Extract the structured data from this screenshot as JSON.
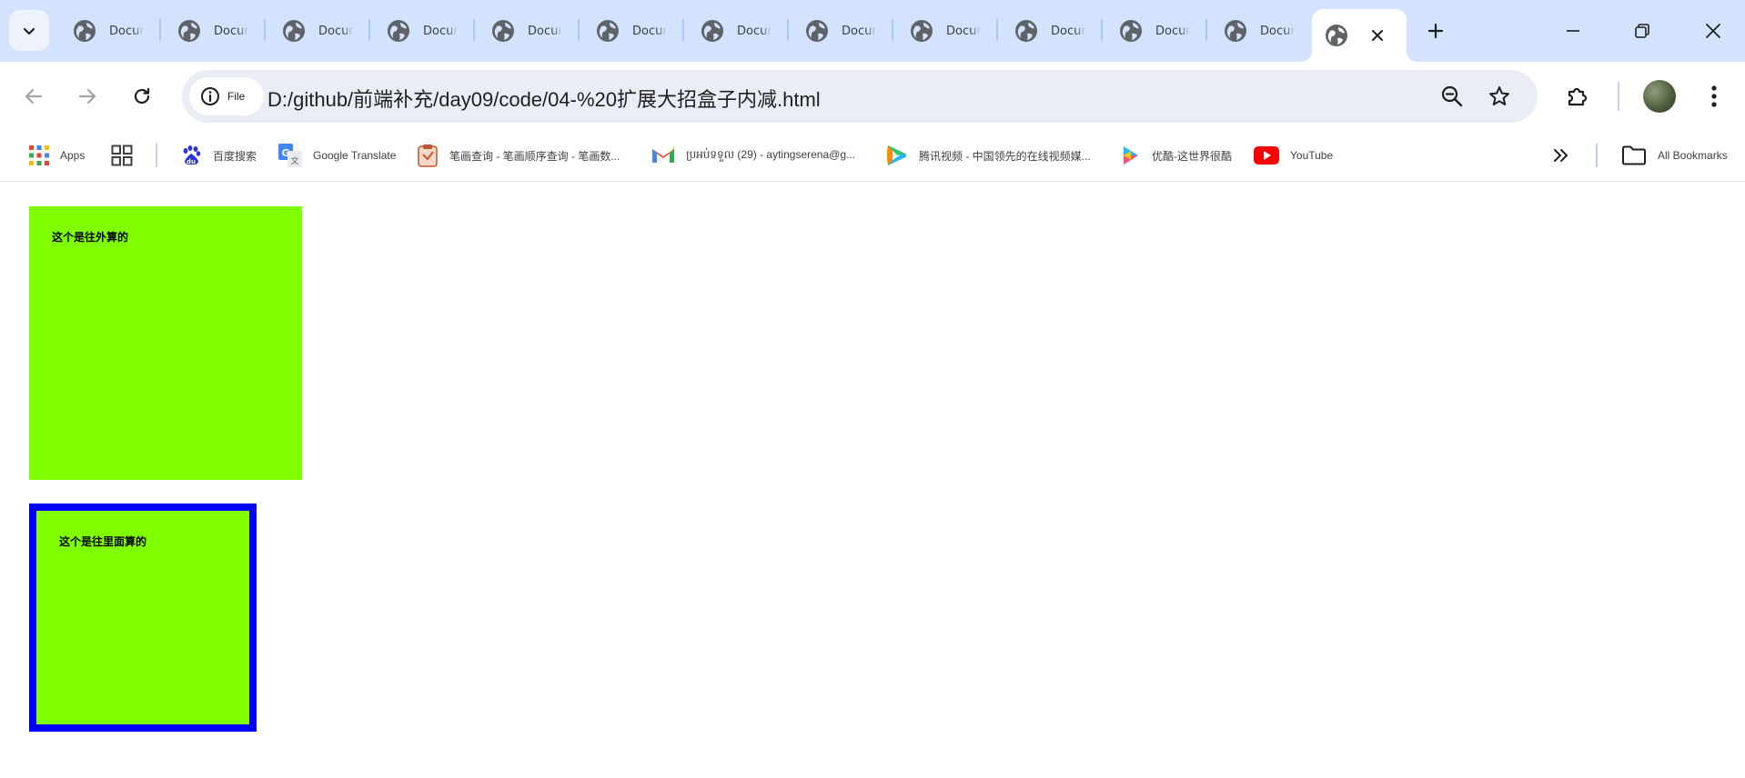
{
  "colors": {
    "tabstrip_bg": "#d3e3fd",
    "omnibox_bg": "#e9eef6",
    "box_bg": "#7fff00",
    "box_border": "#0000ff"
  },
  "tabs": [
    {
      "title": "Docum",
      "icon": "globe-icon"
    },
    {
      "title": "Docum",
      "icon": "globe-icon"
    },
    {
      "title": "Docum",
      "icon": "globe-icon"
    },
    {
      "title": "Docum",
      "icon": "globe-icon"
    },
    {
      "title": "Docum",
      "icon": "globe-icon"
    },
    {
      "title": "Docum",
      "icon": "globe-icon"
    },
    {
      "title": "Docum",
      "icon": "globe-icon"
    },
    {
      "title": "Docum",
      "icon": "globe-icon"
    },
    {
      "title": "Docum",
      "icon": "globe-icon"
    },
    {
      "title": "Docum",
      "icon": "globe-icon"
    },
    {
      "title": "Docum",
      "icon": "globe-icon"
    },
    {
      "title": "Docum",
      "icon": "globe-icon"
    }
  ],
  "active_tab": {
    "icon": "globe-icon"
  },
  "omnibox": {
    "chip_label": "File",
    "url": "D:/github/前端补充/day09/code/04-%20扩展大招盒子内减.html"
  },
  "bookmarks": {
    "items": [
      {
        "label": "Apps",
        "icon": "apps-grid-icon"
      },
      {
        "label": "百度搜索",
        "icon": "baidu-icon"
      },
      {
        "label": "Google Translate",
        "icon": "google-translate-icon"
      },
      {
        "label": "笔画查询 - 笔画顺序查询 - 笔画数...",
        "icon": "clipboard-icon"
      },
      {
        "label": "ប្រអប់ទទួល (29) - aytingserena@g...",
        "icon": "gmail-icon"
      },
      {
        "label": "腾讯视频 - 中国领先的在线视频媒...",
        "icon": "tencent-video-icon"
      },
      {
        "label": "优酷-这世界很酷",
        "icon": "youku-icon"
      },
      {
        "label": "YouTube",
        "icon": "youtube-icon"
      }
    ],
    "all_bookmarks": "All Bookmarks"
  },
  "page": {
    "box1_text": "这个是往外算的",
    "box2_text": "这个是往里面算的"
  }
}
